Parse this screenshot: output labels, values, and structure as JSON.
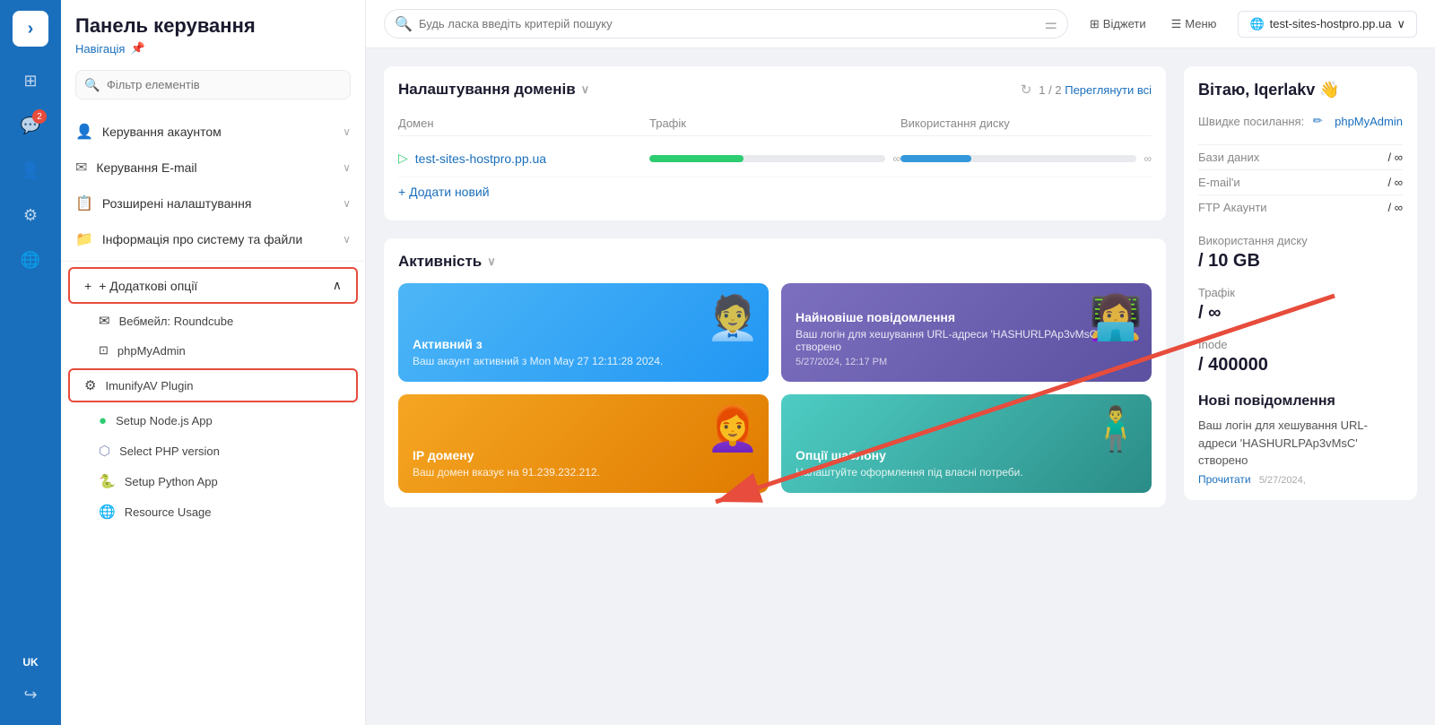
{
  "iconbar": {
    "logo_symbol": "›",
    "lang": "UK",
    "items": [
      {
        "name": "grid-icon",
        "symbol": "⊞",
        "active": false
      },
      {
        "name": "chat-icon",
        "symbol": "💬",
        "active": false,
        "badge": "2"
      },
      {
        "name": "user-icon",
        "symbol": "👤",
        "active": false
      },
      {
        "name": "gear-icon",
        "symbol": "⚙",
        "active": false
      },
      {
        "name": "globe-icon",
        "symbol": "🌐",
        "active": false
      },
      {
        "name": "logout-icon",
        "symbol": "⬡",
        "active": false
      }
    ]
  },
  "sidebar": {
    "title": "Панель керування",
    "subtitle": "Навігація",
    "filter_placeholder": "Фільтр елементів",
    "menu_items": [
      {
        "label": "Керування акаунтом",
        "icon": "👤",
        "has_chevron": true
      },
      {
        "label": "Керування E-mail",
        "icon": "✉",
        "has_chevron": true
      },
      {
        "label": "Розширені налаштування",
        "icon": "📋",
        "has_chevron": true
      },
      {
        "label": "Інформація про систему та файли",
        "icon": "📁",
        "has_chevron": true
      }
    ],
    "additional_options_label": "+ Додаткові опції",
    "sub_items": [
      {
        "label": "Вебмейл: Roundcube",
        "icon": "✉"
      },
      {
        "label": "phpMyAdmin",
        "icon": "🔧"
      },
      {
        "label": "ImunifyAV Plugin",
        "icon": "⚙",
        "highlighted": true
      },
      {
        "label": "Setup Node.js App",
        "icon": "🟢"
      },
      {
        "label": "Select PHP version",
        "icon": "🐘"
      },
      {
        "label": "Setup Python App",
        "icon": "🐍"
      },
      {
        "label": "Resource Usage",
        "icon": "🌐"
      }
    ]
  },
  "topbar": {
    "search_placeholder": "Будь ласка введіть критерій пошуку",
    "tabs": [
      {
        "label": "Віджети",
        "icon": "⊞"
      },
      {
        "label": "Меню",
        "icon": "⊟"
      }
    ],
    "domain": "test-sites-hostpro.pp.ua"
  },
  "domains_section": {
    "title": "Налаштування доменів",
    "pagination": "1 / 2",
    "view_all": "Переглянути всі",
    "columns": [
      "Домен",
      "Трафік",
      "Використання диску"
    ],
    "rows": [
      {
        "name": "test-sites-hostpro.pp.ua",
        "traffic_fill": 40,
        "disk_fill": 30,
        "traffic_inf": "∞",
        "disk_inf": "∞"
      }
    ],
    "add_new": "+ Додати новий"
  },
  "activity_section": {
    "title": "Активність",
    "cards": [
      {
        "id": "active-since",
        "color": "blue",
        "title": "Активний з",
        "text": "Ваш акаунт активний з Mon May 27 12:11:28 2024.",
        "illustration": "🧑‍💼"
      },
      {
        "id": "latest-notification",
        "color": "purple",
        "title": "Найновіше повідомлення",
        "text": "Ваш логін для хешування URL-адреси 'HASHURLPAp3vMsC' створено",
        "date": "5/27/2024, 12:17 PM",
        "illustration": "👩‍💻"
      },
      {
        "id": "ip-domain",
        "color": "orange",
        "title": "IP домену",
        "text": "Ваш домен вказує на 91.239.232.212.",
        "illustration": "👩‍🦰"
      },
      {
        "id": "template-options",
        "color": "teal",
        "title": "Опції шаблону",
        "text": "Налаштуйте оформлення під власні потреби.",
        "illustration": "👨‍💼"
      }
    ]
  },
  "right_panel": {
    "greeting": "Вітаю, Iqerlakv 👋",
    "quick_links_label": "Швидке посилання:",
    "quick_links_edit_icon": "✏",
    "phpmyadmin_link": "phpMyAdmin",
    "stats": [
      {
        "label": "Бази даних",
        "value": "/ ∞"
      },
      {
        "label": "E-mail'и",
        "value": "/ ∞"
      },
      {
        "label": "FTP Акаунти",
        "value": "/ ∞"
      }
    ],
    "disk_usage_label": "Використання диску",
    "disk_value": "/ 10 GB",
    "traffic_label": "Трафік",
    "traffic_value": "/ ∞",
    "inode_label": "Inode",
    "inode_value": "/ 400000",
    "notifications_title": "Нові повідомлення",
    "notification_text": "Ваш логін для хешування URL-адреси 'HASHURLPAp3vMsC' створено",
    "notification_link": "Прочитати",
    "notification_date": "5/27/2024,"
  }
}
